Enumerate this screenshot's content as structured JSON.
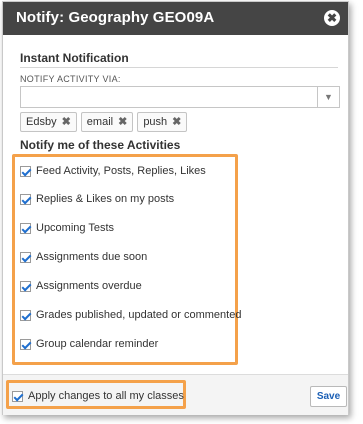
{
  "dialog": {
    "title": "Notify: Geography  GEO09A",
    "close_symbol": "✖"
  },
  "instant": {
    "heading": "Instant Notification",
    "field_label": "NOTIFY ACTIVITY VIA:",
    "caret_symbol": "▼",
    "tags": [
      {
        "label": "Edsby",
        "remove": "✖"
      },
      {
        "label": "email",
        "remove": "✖"
      },
      {
        "label": "push",
        "remove": "✖"
      }
    ]
  },
  "activities": {
    "heading": "Notify me of these Activities",
    "items": [
      {
        "label": "Feed Activity, Posts, Replies, Likes",
        "checked": true
      },
      {
        "label": "Replies & Likes on my posts",
        "checked": true
      },
      {
        "label": "Upcoming Tests",
        "checked": true
      },
      {
        "label": "Assignments due soon",
        "checked": true
      },
      {
        "label": "Assignments overdue",
        "checked": true
      },
      {
        "label": "Grades published, updated or commented",
        "checked": true
      },
      {
        "label": "Group calendar reminder",
        "checked": true
      }
    ]
  },
  "footer": {
    "apply_label": "Apply changes to all my classes",
    "apply_checked": true,
    "save_label": "Save"
  },
  "colors": {
    "titlebar": "#454545",
    "highlight": "#f4a14a",
    "check": "#1f6fcf",
    "save_text": "#1b5fb5"
  }
}
